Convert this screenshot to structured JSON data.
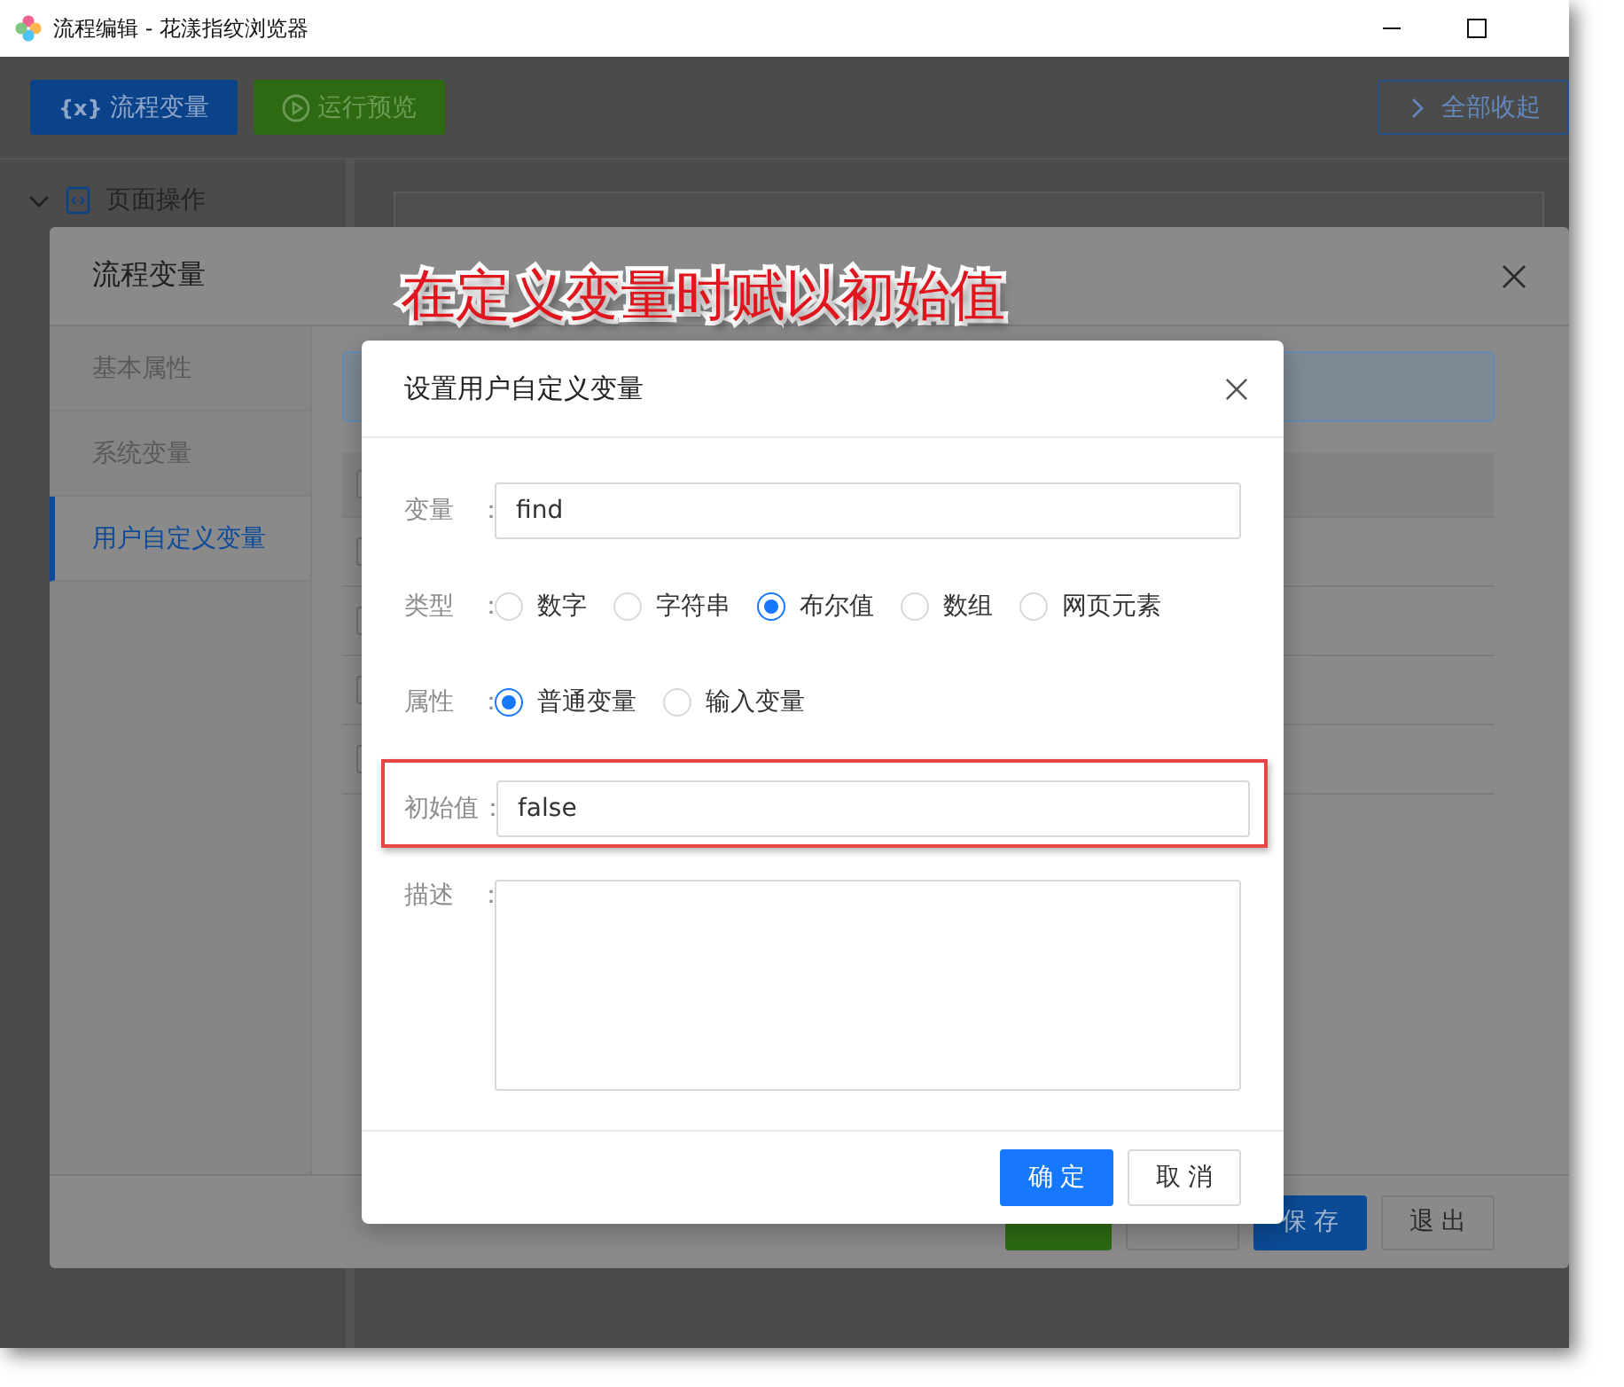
{
  "window": {
    "title": "流程编辑 - 花漾指纹浏览器"
  },
  "toolbar": {
    "buttons": [
      {
        "label": "流程变量",
        "kind": "variables",
        "icon_text": "{x}"
      },
      {
        "label": "运行预览",
        "kind": "preview"
      }
    ],
    "collapse_button": "全部收起"
  },
  "sidebar": {
    "items": [
      {
        "label": "页面操作",
        "expanded": true
      }
    ]
  },
  "annotation": "在定义变量时赋以初始值",
  "variables_dialog": {
    "title": "流程变量",
    "nav": [
      {
        "label": "基本属性",
        "selected": false,
        "disabled": true
      },
      {
        "label": "系统变量",
        "selected": false,
        "disabled": true
      },
      {
        "label": "用户自定义变量",
        "selected": true,
        "disabled": false
      }
    ],
    "table": {
      "header_checked": false,
      "rows": [
        {
          "checked": false
        },
        {
          "checked": false
        },
        {
          "checked": false
        },
        {
          "checked": false
        }
      ]
    },
    "buttons": [
      {
        "kind": "success"
      },
      {
        "kind": "blank"
      },
      {
        "label": "保 存",
        "kind": "primary"
      },
      {
        "label": "退 出",
        "kind": "default"
      }
    ]
  },
  "form_dialog": {
    "title": "设置用户自定义变量",
    "fields": [
      {
        "kind": "text",
        "label": "变量",
        "colon": "：",
        "value": "find",
        "highlighted": false
      },
      {
        "kind": "radio",
        "label": "类型",
        "colon": "：",
        "options": [
          {
            "label": "数字",
            "selected": false
          },
          {
            "label": "字符串",
            "selected": false
          },
          {
            "label": "布尔值",
            "selected": true
          },
          {
            "label": "数组",
            "selected": false
          },
          {
            "label": "网页元素",
            "selected": false
          }
        ]
      },
      {
        "kind": "radio",
        "label": "属性",
        "colon": "：",
        "options": [
          {
            "label": "普通变量",
            "selected": true
          },
          {
            "label": "输入变量",
            "selected": false
          }
        ]
      },
      {
        "kind": "text",
        "label": "初始值",
        "colon": "：",
        "value": "false",
        "highlighted": true
      },
      {
        "kind": "textarea",
        "label": "描述",
        "colon": "："
      }
    ],
    "buttons": [
      {
        "label": "确 定",
        "kind": "primary"
      },
      {
        "label": "取 消",
        "kind": "default"
      }
    ]
  }
}
